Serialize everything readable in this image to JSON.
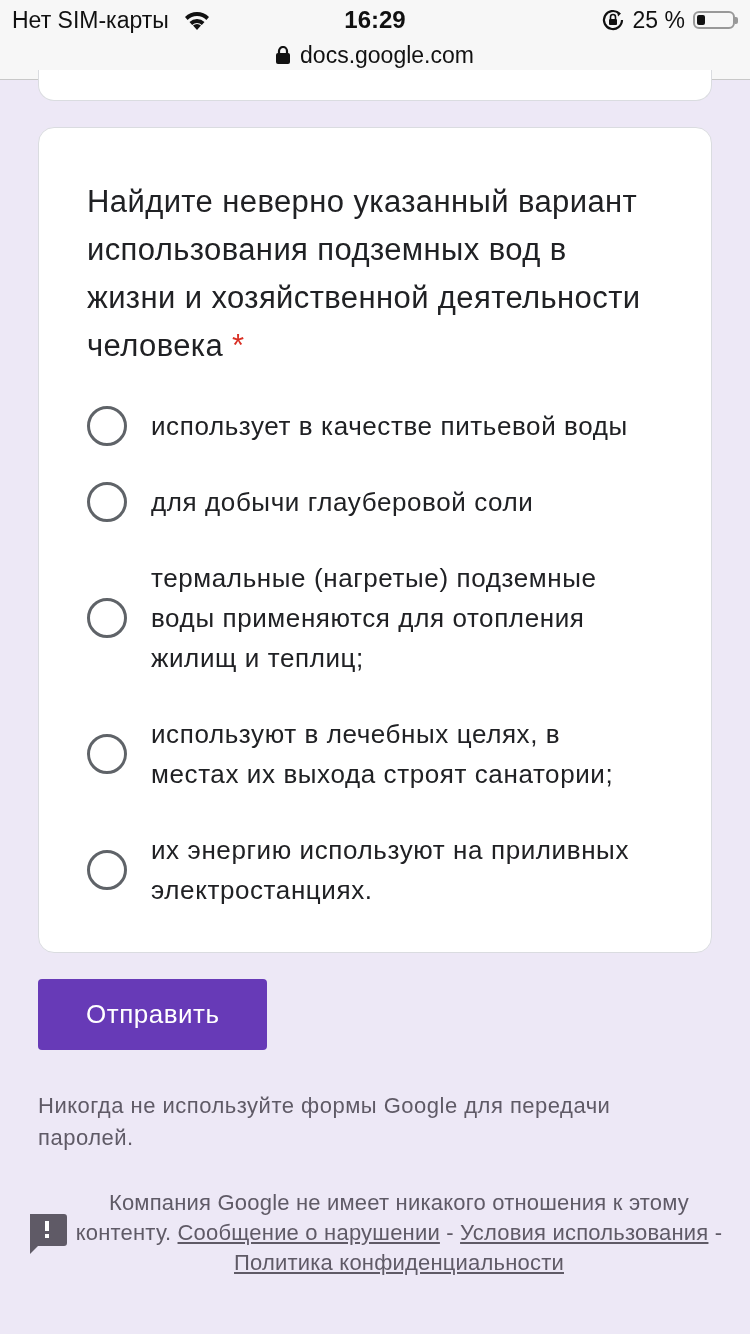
{
  "status_bar": {
    "carrier": "Нет SIM-карты",
    "time": "16:29",
    "battery": "25 %"
  },
  "address_bar": {
    "url": "docs.google.com"
  },
  "question": {
    "title": "Найдите неверно указанный вариант использования подземных вод в жизни и хозяйственной деятельности человека",
    "required": true,
    "required_mark": "*",
    "options": [
      {
        "label": "использует в качестве питьевой воды",
        "selected": false
      },
      {
        "label": "для добычи глауберовой соли",
        "selected": false
      },
      {
        "label": "термальные (нагретые) подземные воды применяются для отопления жилищ и теплиц;",
        "selected": false
      },
      {
        "label": "используют в лечебных целях, в местах их выхода строят санатории;",
        "selected": false
      },
      {
        "label": "их энергию используют на приливных электростанциях.",
        "selected": false
      }
    ]
  },
  "submit_button": "Отправить",
  "password_warning": "Никогда не используйте формы Google для передачи паролей.",
  "footer": {
    "notice": "Компания Google не имеет никакого отношения к этому контенту.",
    "separator": "-",
    "links": [
      "Сообщение о нарушении",
      "Условия использования",
      "Политика конфиденциальности"
    ]
  }
}
